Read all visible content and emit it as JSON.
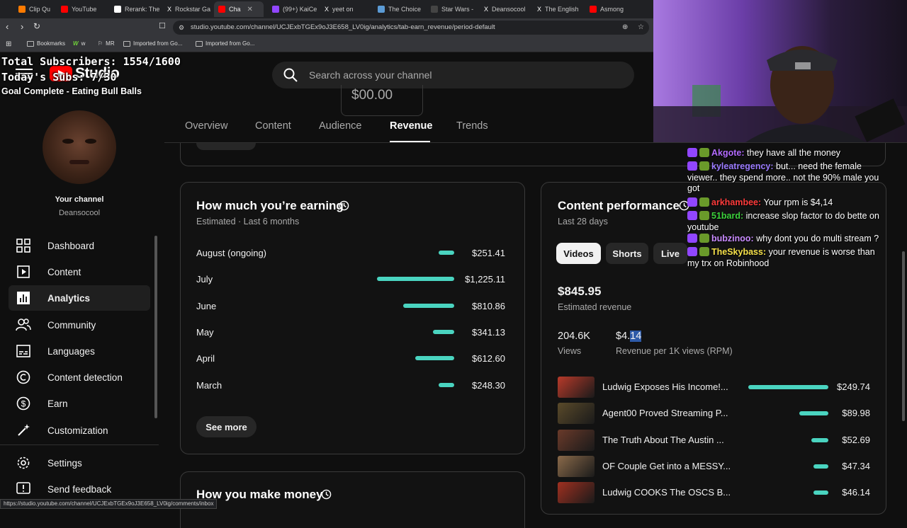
{
  "browser": {
    "tabs": [
      {
        "label": "Clip Qu",
        "color": "#ff7b00"
      },
      {
        "label": "YouTube",
        "color": "#ff0000"
      },
      {
        "label": "Rerank: The",
        "color": "#ffffff"
      },
      {
        "label": "Rockstar Ga",
        "color": "#111111"
      },
      {
        "label": "Cha",
        "color": "#ff0000"
      },
      {
        "label": "(99+) KaiCe",
        "color": "#9146ff"
      },
      {
        "label": "yeet on",
        "color": "#111111"
      },
      {
        "label": "The Choice",
        "color": "#5b9bd5"
      },
      {
        "label": "Star Wars -",
        "color": "#222222"
      },
      {
        "label": "Deansocool",
        "color": "#111111"
      },
      {
        "label": "The English",
        "color": "#111111"
      },
      {
        "label": "Asmong",
        "color": "#ff0000"
      }
    ],
    "url": "studio.youtube.com/channel/UCJExbTGEx9oJ3E658_LV0ig/analytics/tab-earn_revenue/period-default",
    "bookmarks": [
      "Bookmarks",
      "w",
      "MR",
      "Imported from Go...",
      "Imported from Go..."
    ],
    "status_url": "https://studio.youtube.com/channel/UCJExbTGEx9oJ3E658_LV0ig/comments/inbox"
  },
  "studio": {
    "logo_text": "Studio",
    "search_placeholder": "Search across your channel",
    "partial_value": "$00.00"
  },
  "overlay": {
    "total_subscribers": "Total Subscribers: 1554/1600",
    "today_subs": "Today's Subs: 7/30",
    "goal": "Goal Complete - Eating Bull Balls"
  },
  "sidebar": {
    "your_channel": "Your channel",
    "channel_name": "Deansocool",
    "items": [
      {
        "label": "Dashboard",
        "icon": "dashboard-icon"
      },
      {
        "label": "Content",
        "icon": "content-icon"
      },
      {
        "label": "Analytics",
        "icon": "analytics-icon"
      },
      {
        "label": "Community",
        "icon": "community-icon"
      },
      {
        "label": "Languages",
        "icon": "subtitles-icon"
      },
      {
        "label": "Content detection",
        "icon": "copyright-icon"
      },
      {
        "label": "Earn",
        "icon": "dollar-icon"
      },
      {
        "label": "Customization",
        "icon": "magic-wand-icon"
      }
    ],
    "settings": "Settings",
    "feedback": "Send feedback"
  },
  "tabs": [
    "Overview",
    "Content",
    "Audience",
    "Revenue",
    "Trends"
  ],
  "earning_card": {
    "title": "How much you’re earning",
    "subtitle": "Estimated · Last 6 months",
    "rows": [
      {
        "month": "August (ongoing)",
        "value": "$251.41",
        "amount": 251.41
      },
      {
        "month": "July",
        "value": "$1,225.11",
        "amount": 1225.11
      },
      {
        "month": "June",
        "value": "$810.86",
        "amount": 810.86
      },
      {
        "month": "May",
        "value": "$341.13",
        "amount": 341.13
      },
      {
        "month": "April",
        "value": "$612.60",
        "amount": 612.6
      },
      {
        "month": "March",
        "value": "$248.30",
        "amount": 248.3
      }
    ],
    "see_more": "See more"
  },
  "make_money_card": {
    "title": "How you make money"
  },
  "performance_card": {
    "title": "Content performance",
    "subtitle": "Last 28 days",
    "chips": [
      "Videos",
      "Shorts",
      "Live"
    ],
    "revenue_value": "$845.95",
    "revenue_label": "Estimated revenue",
    "views_value": "204.6K",
    "views_label": "Views",
    "rpm_prefix": "$4.",
    "rpm_highlight": "14",
    "rpm_label": "Revenue per 1K views (RPM)",
    "videos": [
      {
        "title": "Ludwig Exposes His Income!...",
        "value": "$249.74",
        "amount": 249.74,
        "thumb": "#b83a2a"
      },
      {
        "title": "Agent00 Proved Streaming P...",
        "value": "$89.98",
        "amount": 89.98,
        "thumb": "#5a4a2a"
      },
      {
        "title": "The Truth About The Austin ...",
        "value": "$52.69",
        "amount": 52.69,
        "thumb": "#6a3a2a"
      },
      {
        "title": "OF Couple Get into a MESSY...",
        "value": "$47.34",
        "amount": 47.34,
        "thumb": "#8a6a4a"
      },
      {
        "title": "Ludwig COOKS The OSCS B...",
        "value": "$46.14",
        "amount": 46.14,
        "thumb": "#a03020"
      }
    ]
  },
  "chat": [
    {
      "user": "Akgote",
      "color": "#b36bff",
      "msg": "they have all the money"
    },
    {
      "user": "kyleatregency",
      "color": "#9b7bff",
      "msg": "but... need the female viewer.. they spend more.. not the 90% male you got"
    },
    {
      "user": "arkhambee",
      "color": "#ff3b3b",
      "msg": "Your rpm is $4,14"
    },
    {
      "user": "51bard",
      "color": "#3cd23c",
      "msg": "increase slop factor to do bette on youtube"
    },
    {
      "user": "bubzinoo",
      "color": "#c98bff",
      "msg": "why dont you do multi stream ?"
    },
    {
      "user": "TheSkybass",
      "color": "#f5e04a",
      "msg": "your revenue is worse than my trx on Robinhood"
    }
  ]
}
